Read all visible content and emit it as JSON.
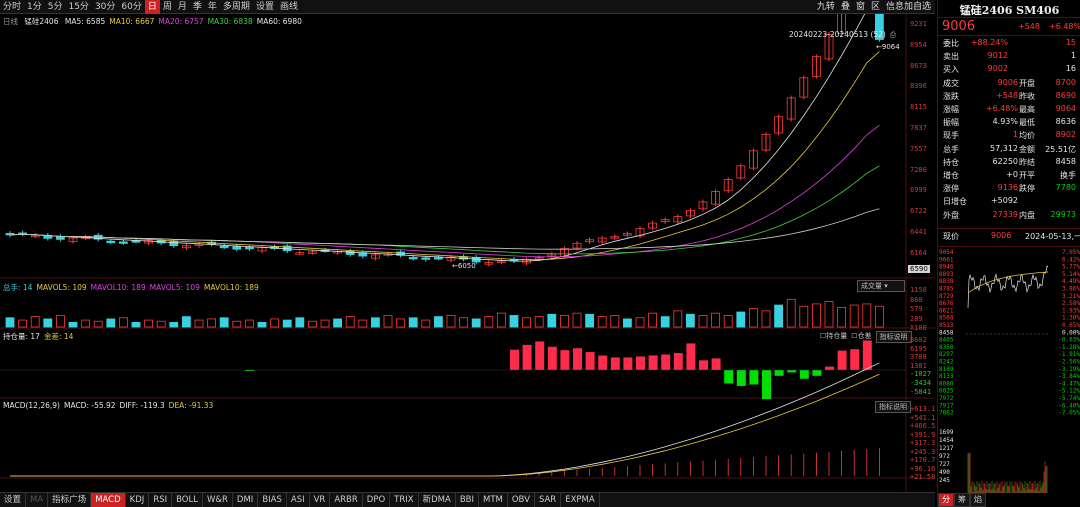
{
  "toolbar": {
    "items": [
      "分时",
      "1分",
      "5分",
      "15分",
      "30分",
      "60分",
      "日",
      "周",
      "月",
      "季",
      "年",
      "多周期",
      "设置",
      "画线"
    ],
    "active_index": 6,
    "right_items": [
      "九转",
      "叠",
      "窗",
      "区",
      "信息加自选"
    ]
  },
  "main": {
    "period_label": "日线",
    "symbol": "锰硅2406",
    "ma_items": [
      {
        "label": "MA5: 6585",
        "color": "#e6e6e6"
      },
      {
        "label": "MA10: 6667",
        "color": "#e8c840"
      },
      {
        "label": "MA20: 6757",
        "color": "#e040e0"
      },
      {
        "label": "MA30: 6838",
        "color": "#40d040"
      },
      {
        "label": "MA60: 6980",
        "color": "#e6e6e6"
      }
    ],
    "range_label": "20240223-20240513 (52)",
    "high_marker": "9064",
    "low_marker": "6050",
    "y_labels": [
      "9231",
      "8954",
      "8673",
      "8396",
      "8115",
      "7837",
      "7557",
      "7280",
      "6999",
      "6722",
      "6441",
      "6164"
    ],
    "price_tag": "6590"
  },
  "volume": {
    "legend": [
      {
        "label": "总手: 14",
        "color": "#39d1e0"
      },
      {
        "label": "MAVOL5: 109",
        "color": "#e8c840"
      },
      {
        "label": "MAVOL10: 189",
        "color": "#e040e0"
      },
      {
        "label": "MAVOL5: 109",
        "color": "#e040e0"
      },
      {
        "label": "MAVOL10: 189",
        "color": "#e8c840"
      }
    ],
    "button": "成交量",
    "y_labels": [
      "1158",
      "868",
      "579",
      "289",
      "X100"
    ],
    "values": [
      40,
      30,
      45,
      35,
      50,
      20,
      30,
      25,
      35,
      40,
      20,
      30,
      25,
      20,
      45,
      30,
      35,
      40,
      25,
      30,
      20,
      35,
      30,
      40,
      25,
      30,
      35,
      45,
      30,
      40,
      50,
      35,
      40,
      30,
      45,
      50,
      40,
      35,
      45,
      60,
      50,
      40,
      45,
      55,
      50,
      60,
      55,
      45,
      50,
      35,
      40,
      60,
      45,
      70,
      55,
      50,
      60,
      50,
      65,
      80,
      70,
      95,
      120,
      90,
      100,
      110,
      85,
      95,
      100,
      90
    ],
    "bar_colors": [
      "c",
      "r",
      "r",
      "c",
      "r",
      "c",
      "r",
      "r",
      "c",
      "r",
      "c",
      "r",
      "r",
      "c",
      "c",
      "r",
      "r",
      "c",
      "r",
      "r",
      "c",
      "r",
      "c",
      "c",
      "r",
      "r",
      "c",
      "r",
      "r",
      "c",
      "r",
      "r",
      "c",
      "r",
      "c",
      "r",
      "r",
      "c",
      "r",
      "r",
      "c",
      "r",
      "r",
      "c",
      "r",
      "r",
      "c",
      "r",
      "r",
      "c",
      "r",
      "r",
      "c",
      "r",
      "c",
      "r",
      "r",
      "r",
      "c",
      "r",
      "r",
      "c",
      "r",
      "r",
      "r",
      "r",
      "r",
      "r",
      "r",
      "r"
    ]
  },
  "oi": {
    "legend": [
      {
        "label": "持仓量: 17",
        "color": "#e6e6e6"
      },
      {
        "label": "金差: 14",
        "color": "#e8c840"
      }
    ],
    "buttons": [
      "持仓量",
      "仓差",
      "指标说明"
    ],
    "y_labels": [
      "8602",
      "6195",
      "3788",
      "1381",
      "-1027",
      "-3434",
      "-5841"
    ],
    "values": [
      0,
      0,
      0,
      0,
      0,
      0,
      0,
      0,
      0,
      0,
      0,
      0,
      0,
      0,
      0,
      0,
      0,
      0,
      0,
      -200,
      0,
      0,
      0,
      0,
      0,
      0,
      0,
      0,
      0,
      0,
      0,
      0,
      0,
      0,
      0,
      0,
      0,
      0,
      0,
      0,
      4200,
      5200,
      5900,
      4800,
      4100,
      4500,
      3700,
      3000,
      2600,
      2600,
      2800,
      3000,
      3200,
      3500,
      5500,
      2000,
      2400,
      -2800,
      -3300,
      -3000,
      -6000,
      -1200,
      -500,
      -1800,
      -1200,
      700,
      4000,
      4300,
      6100
    ]
  },
  "macd": {
    "legend": [
      {
        "label": "MACD(12,26,9)",
        "color": "#e6e6e6"
      },
      {
        "label": "MACD: -55.92",
        "color": "#e6e6e6"
      },
      {
        "label": "DIFF: -119.3",
        "color": "#e6e6e6"
      },
      {
        "label": "DEA: -91.33",
        "color": "#e8c840"
      }
    ],
    "button": "指标说明",
    "y_labels": [
      "+613.1",
      "+541.1",
      "+466.5",
      "+391.9",
      "+317.3",
      "+245.3",
      "+170.7",
      "+96.16",
      "+21.58"
    ]
  },
  "indicator_tabs": {
    "items": [
      "设置",
      "MA",
      "指标广场",
      "MACD",
      "KDJ",
      "RSI",
      "BOLL",
      "W&R",
      "DMI",
      "BIAS",
      "ASI",
      "VR",
      "ARBR",
      "DPO",
      "TRIX",
      "新DMA",
      "BBI",
      "MTM",
      "OBV",
      "SAR",
      "EXPMA"
    ],
    "active_index": 3
  },
  "right_panel": {
    "title": "锰硅2406 SM406",
    "price": "9006",
    "change": "+548",
    "change_pct": "+6.48%",
    "rows": [
      {
        "l": "委比",
        "v1": "+88.24%",
        "v1c": "red",
        "v2": "15",
        "v2c": "red"
      },
      {
        "l": "卖出",
        "v1": "9012",
        "v1c": "red",
        "v2": "1",
        "v2c": "white"
      },
      {
        "l": "买入",
        "v1": "9002",
        "v1c": "red",
        "v2": "16",
        "v2c": "white"
      },
      {
        "l": "成交",
        "v1": "9006",
        "v1c": "red",
        "m": "开盘",
        "v2": "8700",
        "v2c": "red"
      },
      {
        "l": "涨跌",
        "v1": "+548",
        "v1c": "red",
        "m": "昨收",
        "v2": "8690",
        "v2c": "red"
      },
      {
        "l": "涨幅",
        "v1": "+6.48%",
        "v1c": "red",
        "m": "最高",
        "v2": "9064",
        "v2c": "red"
      },
      {
        "l": "振幅",
        "v1": "4.93%",
        "v1c": "white",
        "m": "最低",
        "v2": "8636",
        "v2c": "white"
      },
      {
        "l": "现手",
        "v1": "1",
        "v1c": "red",
        "m": "均价",
        "v2": "8902",
        "v2c": "red"
      },
      {
        "l": "总手",
        "v1": "57,312",
        "v1c": "white",
        "m": "金额",
        "v2": "25.51亿",
        "v2c": "white"
      },
      {
        "l": "持仓",
        "v1": "62250",
        "v1c": "white",
        "m": "昨结",
        "v2": "8458",
        "v2c": "white"
      },
      {
        "l": "增仓",
        "v1": "+0",
        "v1c": "white",
        "m": "开平",
        "v2": "换手",
        "v2c": "white"
      },
      {
        "l": "涨停",
        "v1": "9136",
        "v1c": "red",
        "m": "跌停",
        "v2": "7780",
        "v2c": "green"
      },
      {
        "l": "日增仓",
        "v1": "+5092",
        "v1c": "white",
        "m": "",
        "v2": "",
        "v2c": "white"
      },
      {
        "l": "外盘",
        "v1": "27339",
        "v1c": "red",
        "m": "内盘",
        "v2": "29973",
        "v2c": "green"
      }
    ],
    "now_label": "现价",
    "now_price": "9006",
    "now_date": "2024-05-13,一",
    "mini_left": [
      "9054",
      "9001",
      "8946",
      "8893",
      "8838",
      "8785",
      "8729",
      "8676",
      "8621",
      "8568",
      "8513",
      "8458",
      "8405",
      "8350",
      "8297",
      "8242",
      "8189",
      "8133",
      "8080",
      "8025",
      "7972",
      "7917",
      "7862"
    ],
    "mini_right": [
      "7.05%",
      "6.42%",
      "5.77%",
      "5.14%",
      "4.49%",
      "3.86%",
      "3.21%",
      "2.58%",
      "1.93%",
      "1.30%",
      "0.65%",
      "0.00%",
      "-0.63%",
      "-1.28%",
      "-1.91%",
      "-2.56%",
      "-3.19%",
      "-3.84%",
      "-4.47%",
      "-5.12%",
      "-5.74%",
      "-6.40%",
      "-7.05%"
    ],
    "mini_vol": [
      "1699",
      "1454",
      "1217",
      "972",
      "727",
      "490",
      "245"
    ],
    "tabs": [
      "分",
      "筹",
      "焰"
    ],
    "active_tab": 0
  },
  "colors": {
    "up": "#ff3b3b",
    "down": "#39d1e0",
    "grid": "#4a1010"
  }
}
